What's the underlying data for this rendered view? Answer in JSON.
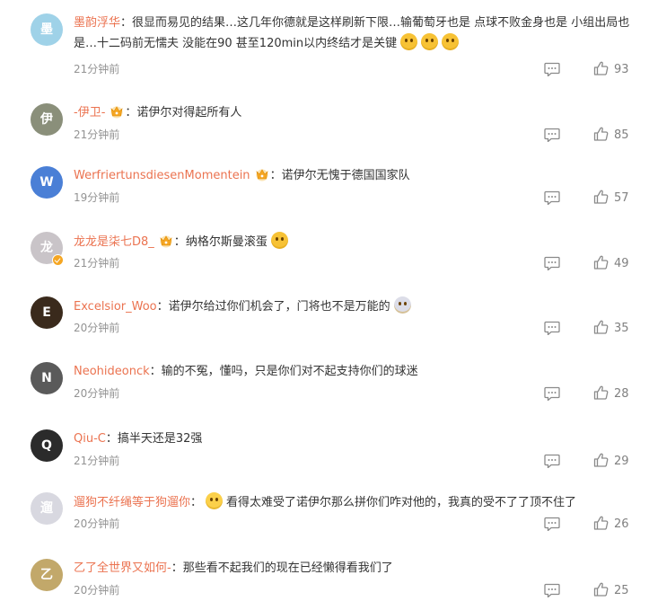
{
  "comments": [
    {
      "username": "墨韵浮华",
      "separator": "：",
      "text": "很显而易见的结果…这几年你德就是这样刷新下限…输葡萄牙也是 点球不败金身也是 小组出局也是…十二码前无懦夫 没能在90 甚至120min以内终结才是关键",
      "emojis": [
        "smile",
        "smile",
        "smile"
      ],
      "time": "21分钟前",
      "likes": "93",
      "avatar_color": "#9fd2e8",
      "avatar_initial": "墨",
      "crown_badge": false,
      "verified": false
    },
    {
      "username": "-伊卫-",
      "separator": "：",
      "text": "诺伊尔对得起所有人",
      "emojis": [],
      "time": "21分钟前",
      "likes": "85",
      "avatar_color": "#8a8f7a",
      "avatar_initial": "伊",
      "crown_badge": true,
      "verified": false
    },
    {
      "username": "WerfriertunsdiesenMomentein",
      "separator": "：",
      "text": "诺伊尔无愧于德国国家队",
      "emojis": [],
      "time": "19分钟前",
      "likes": "57",
      "avatar_color": "#4a7fd6",
      "avatar_initial": "W",
      "crown_badge": true,
      "verified": false
    },
    {
      "username": "龙龙是柒七D8_",
      "separator": "：",
      "text": "纳格尔斯曼滚蛋",
      "emojis": [
        "smile"
      ],
      "time": "21分钟前",
      "likes": "49",
      "avatar_color": "#c9c4c8",
      "avatar_initial": "龙",
      "crown_badge": true,
      "verified": true
    },
    {
      "username": "Excelsior_Woo",
      "separator": "：",
      "text": "诺伊尔给过你们机会了，门将也不是万能的",
      "emojis": [
        "doge"
      ],
      "time": "20分钟前",
      "likes": "35",
      "avatar_color": "#3a2a1c",
      "avatar_initial": "E",
      "crown_badge": false,
      "verified": false
    },
    {
      "username": "Neohideonck",
      "separator": "：",
      "text": "输的不冤，懂吗，只是你们对不起支持你们的球迷",
      "emojis": [],
      "time": "20分钟前",
      "likes": "28",
      "avatar_color": "#5a5a5a",
      "avatar_initial": "N",
      "crown_badge": false,
      "verified": false
    },
    {
      "username": "Qiu-C",
      "separator": "：",
      "text": "搞半天还是32强",
      "emojis": [],
      "time": "21分钟前",
      "likes": "29",
      "avatar_color": "#2b2b2b",
      "avatar_initial": "Q",
      "crown_badge": false,
      "verified": false
    },
    {
      "username": "遛狗不纤绳等于狗遛你",
      "separator": "：",
      "text": "看得太难受了诺伊尔那么拼你们咋对他的，我真的受不了了顶不住了",
      "emojis_before": [
        "cry"
      ],
      "emojis": [],
      "time": "20分钟前",
      "likes": "26",
      "avatar_color": "#d8d8e0",
      "avatar_initial": "遛",
      "crown_badge": false,
      "verified": false
    },
    {
      "username": "乙了全世界又如何-",
      "separator": "：",
      "text": "那些看不起我们的现在已经懒得看我们了",
      "emojis": [],
      "time": "20分钟前",
      "likes": "25",
      "avatar_color": "#c2a86a",
      "avatar_initial": "乙",
      "crown_badge": false,
      "verified": false
    }
  ],
  "colors": {
    "username": "#eb7350",
    "time": "#939393",
    "icon": "#8a8a8a"
  },
  "icons": {
    "reply": "comment-icon",
    "like": "thumbs-up-icon"
  }
}
